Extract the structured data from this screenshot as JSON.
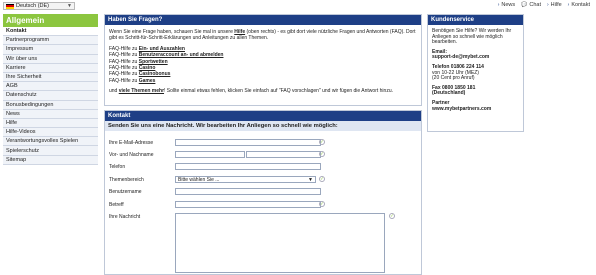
{
  "header": {
    "language": "Deutsch (DE)",
    "nav": [
      "News",
      "Chat",
      "Hilfe",
      "Kontakt"
    ],
    "flag_colors": [
      "#000000",
      "#dd0000",
      "#ffce00"
    ]
  },
  "sidebar": {
    "title": "Allgemein",
    "items": [
      {
        "label": "Kontakt",
        "active": true
      },
      {
        "label": "Partnerprogramm"
      },
      {
        "label": "Impressum"
      },
      {
        "label": "Wir über uns"
      },
      {
        "label": "Karriere"
      },
      {
        "label": "Ihre Sicherheit"
      },
      {
        "label": "AGB"
      },
      {
        "label": "Datenschutz"
      },
      {
        "label": "Bonusbedingungen"
      },
      {
        "label": "News"
      },
      {
        "label": "Hilfe"
      },
      {
        "label": "Hilfe-Videos"
      },
      {
        "label": "Verantwortungsvolles Spielen"
      },
      {
        "label": "Spielerschutz"
      },
      {
        "label": "Sitemap"
      }
    ]
  },
  "faq": {
    "title": "Haben Sie Fragen?",
    "intro_a": "Wenn Sie eine Frage haben, schauen Sie mal in unsere ",
    "intro_link": "Hilfe",
    "intro_b": " (oben rechts) - es gibt dort viele nützliche Fragen und Antworten (FAQ). Dort gibt es Schritt-für-Schritt-Erklärungen und Anleitungen zu allen Themen.",
    "links": [
      {
        "prefix": "FAQ-Hilfe zu ",
        "link": "Ein- und Auszahlen"
      },
      {
        "prefix": "FAQ-Hilfe zu ",
        "link": "Benutzeraccount an- und abmelden"
      },
      {
        "prefix": "FAQ-Hilfe zu ",
        "link": "Sportwetten"
      },
      {
        "prefix": "FAQ-Hilfe zu ",
        "link": "Casino"
      },
      {
        "prefix": "FAQ-Hilfe zu ",
        "link": "Casinobonus"
      },
      {
        "prefix": "FAQ-Hilfe zu ",
        "link": "Games"
      }
    ],
    "outro_a": "und ",
    "outro_link": "viele Themen mehr",
    "outro_b": "! Sollte einmal etwas fehlen, klicken Sie einfach auf \"FAQ vorschlagen\" und wir fügen die Antwort hinzu."
  },
  "kontakt": {
    "title": "Kontakt",
    "subtitle": "Senden Sie uns eine Nachricht. Wir bearbeiten Ihr Anliegen so schnell wie möglich:",
    "fields": {
      "email": "Ihre E-Mail-Adresse",
      "name": "Vor- und Nachname",
      "phone": "Telefon",
      "topic": "Themenbereich",
      "topic_value": "Bitte wählen Sie ...",
      "username": "Benutzername",
      "subject": "Betreff",
      "message": "Ihre Nachricht"
    }
  },
  "kundenservice": {
    "title": "Kundenservice",
    "intro": "Benötigen Sie Hilfe? Wir werden Ihr Anliegen so schnell wie möglich bearbeiten.",
    "email_label": "Email:",
    "email": "support-de@mybet.com",
    "phone_label": "Telefon 01806 224 114",
    "phone_hours": "von 10-22 Uhr (MEZ)",
    "phone_cost": "(20 Cent pro Anruf)",
    "fax_label": "Fax 0800 1850 181",
    "fax_country": "(Deutschland)",
    "partner_label": "Partner",
    "partner_url": "www.mybetpartners.com"
  },
  "colors": {
    "accent_green": "#8cc63f",
    "header_blue": "#1e3f86"
  }
}
